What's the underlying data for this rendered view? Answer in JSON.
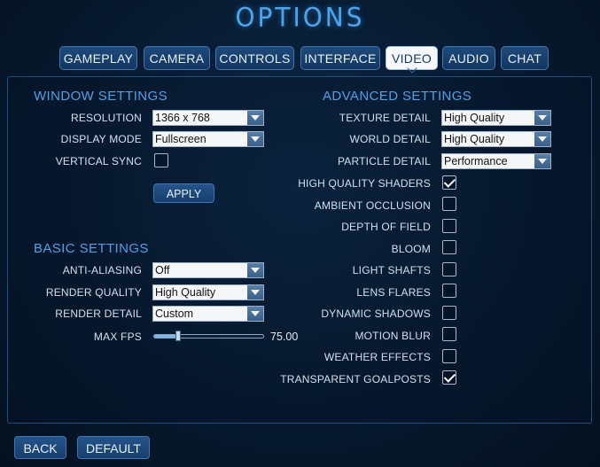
{
  "title": "OPTIONS",
  "tabs": [
    {
      "label": "GAMEPLAY",
      "active": false
    },
    {
      "label": "CAMERA",
      "active": false
    },
    {
      "label": "CONTROLS",
      "active": false
    },
    {
      "label": "INTERFACE",
      "active": false
    },
    {
      "label": "VIDEO",
      "active": true
    },
    {
      "label": "AUDIO",
      "active": false
    },
    {
      "label": "CHAT",
      "active": false
    }
  ],
  "window_settings": {
    "heading": "WINDOW SETTINGS",
    "resolution_label": "RESOLUTION",
    "resolution_value": "1366 x 768",
    "display_mode_label": "DISPLAY MODE",
    "display_mode_value": "Fullscreen",
    "vsync_label": "VERTICAL SYNC",
    "vsync_checked": false,
    "apply_label": "APPLY"
  },
  "basic_settings": {
    "heading": "BASIC SETTINGS",
    "aa_label": "ANTI-ALIASING",
    "aa_value": "Off",
    "render_quality_label": "RENDER QUALITY",
    "render_quality_value": "High Quality",
    "render_detail_label": "RENDER DETAIL",
    "render_detail_value": "Custom",
    "max_fps_label": "MAX FPS",
    "max_fps_value": "75.00",
    "max_fps_fraction": 0.22
  },
  "advanced_settings": {
    "heading": "ADVANCED SETTINGS",
    "texture_label": "TEXTURE DETAIL",
    "texture_value": "High Quality",
    "world_label": "WORLD DETAIL",
    "world_value": "High Quality",
    "particle_label": "PARTICLE DETAIL",
    "particle_value": "Performance",
    "toggles": [
      {
        "label": "HIGH QUALITY SHADERS",
        "checked": true
      },
      {
        "label": "AMBIENT OCCLUSION",
        "checked": false
      },
      {
        "label": "DEPTH OF FIELD",
        "checked": false
      },
      {
        "label": "BLOOM",
        "checked": false
      },
      {
        "label": "LIGHT SHAFTS",
        "checked": false
      },
      {
        "label": "LENS FLARES",
        "checked": false
      },
      {
        "label": "DYNAMIC SHADOWS",
        "checked": false
      },
      {
        "label": "MOTION BLUR",
        "checked": false
      },
      {
        "label": "WEATHER EFFECTS",
        "checked": false
      },
      {
        "label": "TRANSPARENT GOALPOSTS",
        "checked": true
      }
    ]
  },
  "footer": {
    "back_label": "BACK",
    "default_label": "DEFAULT"
  },
  "colors": {
    "accent": "#4fa0e6",
    "background": "#071a30",
    "tab_active_bg": "#f6f8fb"
  }
}
